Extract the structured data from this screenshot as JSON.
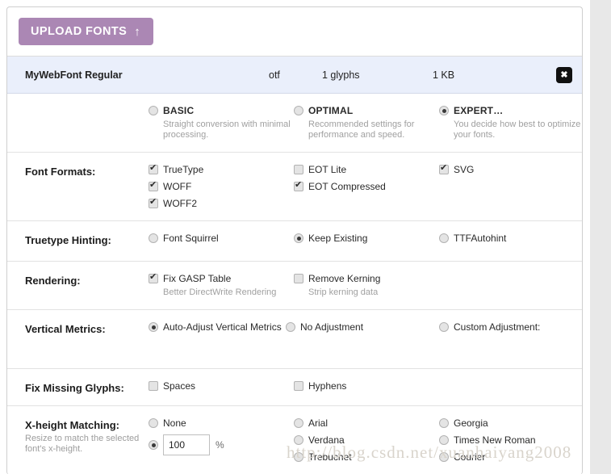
{
  "toolbar": {
    "upload_label": "UPLOAD FONTS",
    "upload_arrow_icon": "arrow-up-icon"
  },
  "font_row": {
    "name": "MyWebFont Regular",
    "type": "otf",
    "glyphs": "1 glyphs",
    "size": "1 KB",
    "delete_icon": "close-x-icon",
    "row_bg": "#eaeffb"
  },
  "conversion_modes": [
    {
      "label": "BASIC",
      "description": "Straight conversion with minimal processing.",
      "selected": false
    },
    {
      "label": "OPTIMAL",
      "description": "Recommended settings for performance and speed.",
      "selected": false
    },
    {
      "label": "EXPERT…",
      "description": "You decide how best to optimize your fonts.",
      "selected": true
    }
  ],
  "sections": {
    "font_formats": {
      "label": "Font Formats:",
      "col1": [
        {
          "label": "TrueType",
          "checked": true
        },
        {
          "label": "WOFF",
          "checked": true
        },
        {
          "label": "WOFF2",
          "checked": true
        }
      ],
      "col2": [
        {
          "label": "EOT Lite",
          "checked": false
        },
        {
          "label": "EOT Compressed",
          "checked": true
        }
      ],
      "col3": [
        {
          "label": "SVG",
          "checked": true
        }
      ]
    },
    "truetype_hinting": {
      "label": "Truetype Hinting:",
      "options": [
        {
          "label": "Font Squirrel",
          "selected": false
        },
        {
          "label": "Keep Existing",
          "selected": true
        },
        {
          "label": "TTFAutohint",
          "selected": false
        }
      ]
    },
    "rendering": {
      "label": "Rendering:",
      "options": [
        {
          "label": "Fix GASP Table",
          "description": "Better DirectWrite Rendering",
          "checked": true
        },
        {
          "label": "Remove Kerning",
          "description": "Strip kerning data",
          "checked": false
        }
      ]
    },
    "vertical_metrics": {
      "label": "Vertical Metrics:",
      "options": [
        {
          "label": "Auto-Adjust Vertical Metrics",
          "selected": true
        },
        {
          "label": "No Adjustment",
          "selected": false
        },
        {
          "label": "Custom Adjustment:",
          "selected": false
        }
      ]
    },
    "fix_missing_glyphs": {
      "label": "Fix Missing Glyphs:",
      "options": [
        {
          "label": "Spaces",
          "checked": false
        },
        {
          "label": "Hyphens",
          "checked": false
        }
      ]
    },
    "x_height_matching": {
      "label": "X-height Matching:",
      "sublabel": "Resize to match the selected font's x-height.",
      "none_option": {
        "label": "None",
        "selected": false
      },
      "percent_option": {
        "selected": true,
        "value": "100",
        "unit": "%"
      },
      "col2": [
        {
          "label": "Arial",
          "selected": false
        },
        {
          "label": "Verdana",
          "selected": false
        },
        {
          "label": "Trebuchet",
          "selected": false
        }
      ],
      "col3": [
        {
          "label": "Georgia",
          "selected": false
        },
        {
          "label": "Times New Roman",
          "selected": false
        },
        {
          "label": "Courier",
          "selected": false
        }
      ]
    }
  },
  "watermark": "http://blog.csdn.net/xuanhaiyang2008"
}
